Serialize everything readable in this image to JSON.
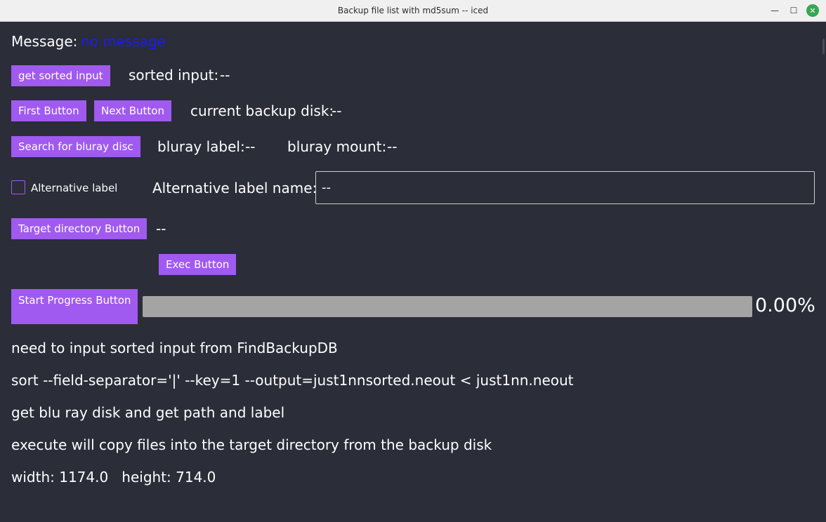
{
  "window": {
    "title": "Backup file list with md5sum -- iced",
    "minimize_glyph": "—",
    "maximize_glyph": "☐",
    "close_glyph": "✕"
  },
  "message": {
    "label": "Message:",
    "value": "no message",
    "value_color": "#1a1aff"
  },
  "sorted": {
    "button": "get sorted input",
    "label": "sorted input:",
    "value": "--"
  },
  "disk": {
    "first_button": "First Button",
    "next_button": "Next Button",
    "label": "current backup disk:",
    "value": "--"
  },
  "bluray": {
    "search_button": "Search for bluray disc",
    "label_label": "bluray label:",
    "label_value": "--",
    "mount_label": "bluray mount:",
    "mount_value": "--"
  },
  "alternative": {
    "checkbox_label": "Alternative label",
    "checked": false,
    "name_label": "Alternative label name:",
    "name_value": "--"
  },
  "target": {
    "button": "Target directory Button",
    "value": "--"
  },
  "exec": {
    "button": "Exec Button"
  },
  "progress": {
    "button": "Start Progress Button",
    "percent_text": "0.00%",
    "value": 0
  },
  "notes": [
    "need to input sorted input from FindBackupDB",
    "sort --field-separator='|' --key=1 --output=just1nnsorted.neout < just1nn.neout",
    "get blu ray disk and get path and label",
    "execute will copy files into the target directory from the backup disk"
  ],
  "dimensions_text": "width: 1174.0   height: 714.0",
  "colors": {
    "background": "#2b2d38",
    "accent": "#a05af0",
    "progress_track": "#a4a4a4"
  }
}
